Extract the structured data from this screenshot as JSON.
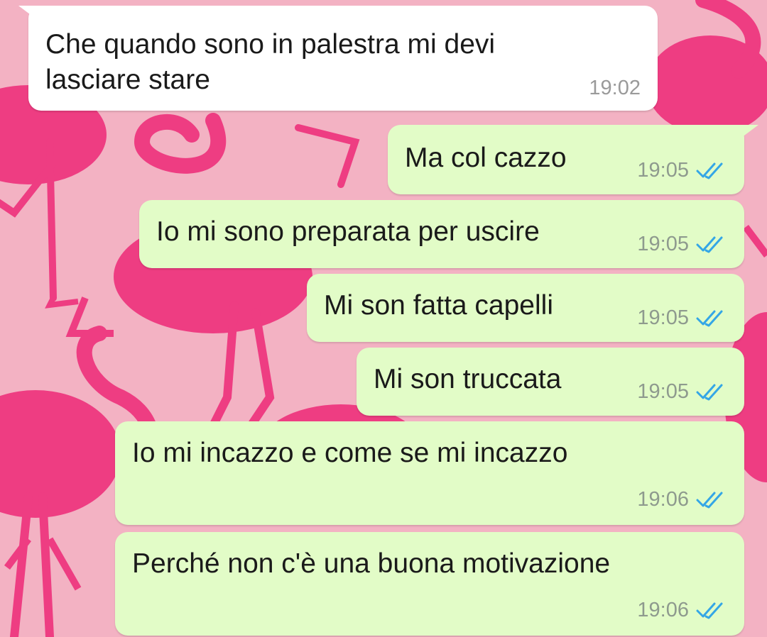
{
  "conversation": {
    "messages": [
      {
        "direction": "incoming",
        "text_line1": "Che quando sono in palestra mi devi",
        "text_line2": "lasciare stare",
        "time": "19:02"
      },
      {
        "direction": "outgoing",
        "text": "Ma col cazzo",
        "time": "19:05",
        "status": "read"
      },
      {
        "direction": "outgoing",
        "text": "Io mi sono preparata per uscire",
        "time": "19:05",
        "status": "read"
      },
      {
        "direction": "outgoing",
        "text": "Mi son fatta capelli",
        "time": "19:05",
        "status": "read"
      },
      {
        "direction": "outgoing",
        "text": "Mi son truccata",
        "time": "19:05",
        "status": "read"
      },
      {
        "direction": "outgoing",
        "text": "Io mi incazzo e come se mi incazzo",
        "time": "19:06",
        "status": "read"
      },
      {
        "direction": "outgoing",
        "text": "Perché non c'è una buona motivazione",
        "time": "19:06",
        "status": "read"
      }
    ]
  },
  "theme": {
    "wallpaper": "flamingo-pattern",
    "wallpaper_bg": "#f3b2c3",
    "flamingo_color": "#ee3d82",
    "incoming_bubble": "#ffffff",
    "outgoing_bubble": "#e2fcc7",
    "read_tick_color": "#34a6e6"
  }
}
